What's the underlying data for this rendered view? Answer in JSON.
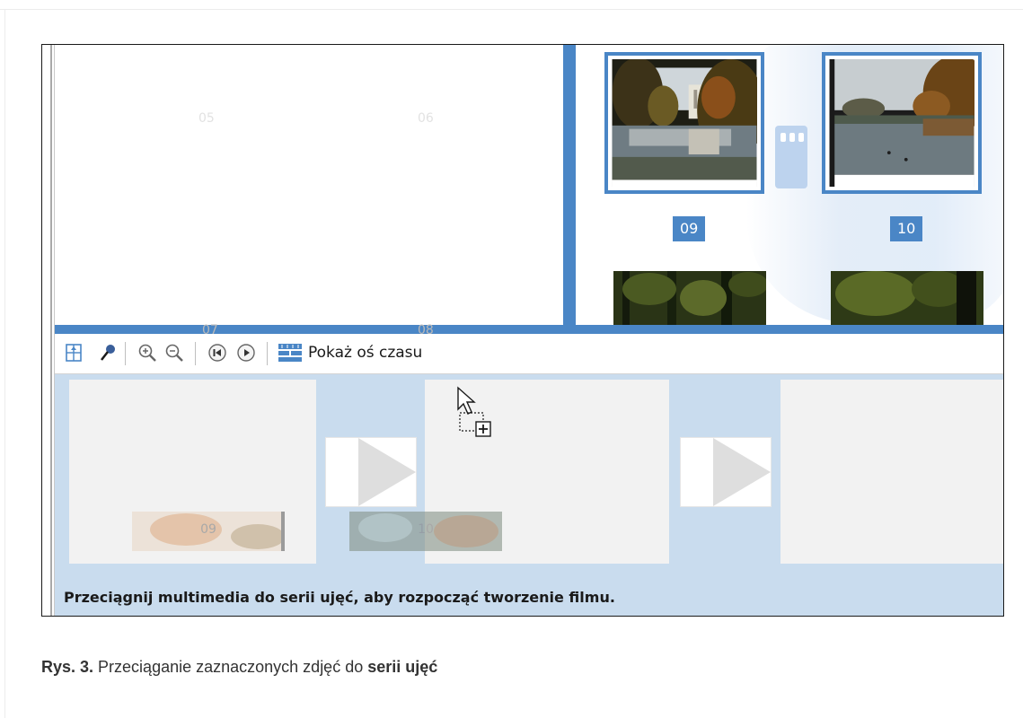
{
  "library": {
    "ghost_numbers": [
      "05",
      "06",
      "07",
      "08"
    ],
    "thumbnails": [
      {
        "label": "09",
        "selected": true
      },
      {
        "label": "10",
        "selected": true
      }
    ]
  },
  "toolbar": {
    "show_timeline_label": "Pokaż oś czasu",
    "icons": [
      "storyboard-narration-icon",
      "audio-levels-icon",
      "zoom-in-icon",
      "zoom-out-icon",
      "rewind-icon",
      "play-icon",
      "timeline-icon"
    ]
  },
  "storyboard": {
    "drag_items": [
      "09",
      "10"
    ],
    "status_text": "Przeciągnij multimedia do serii ujęć, aby rozpocząć tworzenie filmu."
  },
  "caption": {
    "prefix": "Rys. 3.",
    "text": " Przeciąganie zaznaczonych zdjęć do ",
    "bold": "serii ujęć"
  },
  "colors": {
    "accent": "#4a86c6",
    "storyboard_bg": "#c9dcee",
    "cell_bg": "#f2f2f2"
  }
}
